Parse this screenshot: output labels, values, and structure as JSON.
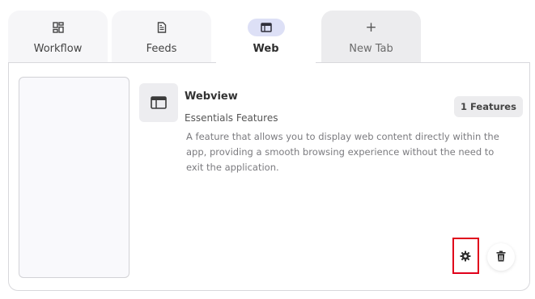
{
  "tabs": [
    {
      "label": "Workflow",
      "icon": "dashboard-icon",
      "active": false
    },
    {
      "label": "Feeds",
      "icon": "document-icon",
      "active": false
    },
    {
      "label": "Web",
      "icon": "browser-window-icon",
      "active": true
    },
    {
      "label": "New Tab",
      "icon": "plus-icon",
      "active": false
    }
  ],
  "new_tab_symbol": "+",
  "feature": {
    "icon": "browser-window-icon",
    "title": "Webview",
    "subtitle": "Essentials Features",
    "description": "A feature that allows you to display web content directly within the app, providing a smooth browsing experience without the need to exit the application.",
    "badge": "1 Features"
  },
  "actions": {
    "settings_icon": "gear-icon",
    "delete_icon": "trash-icon",
    "highlight_color": "#e0001b"
  },
  "colors": {
    "active_tab_pill": "#dde0f6",
    "tab_background": "#f6f6f8",
    "new_tab_background": "#ececee",
    "border": "#d8d8dc"
  }
}
